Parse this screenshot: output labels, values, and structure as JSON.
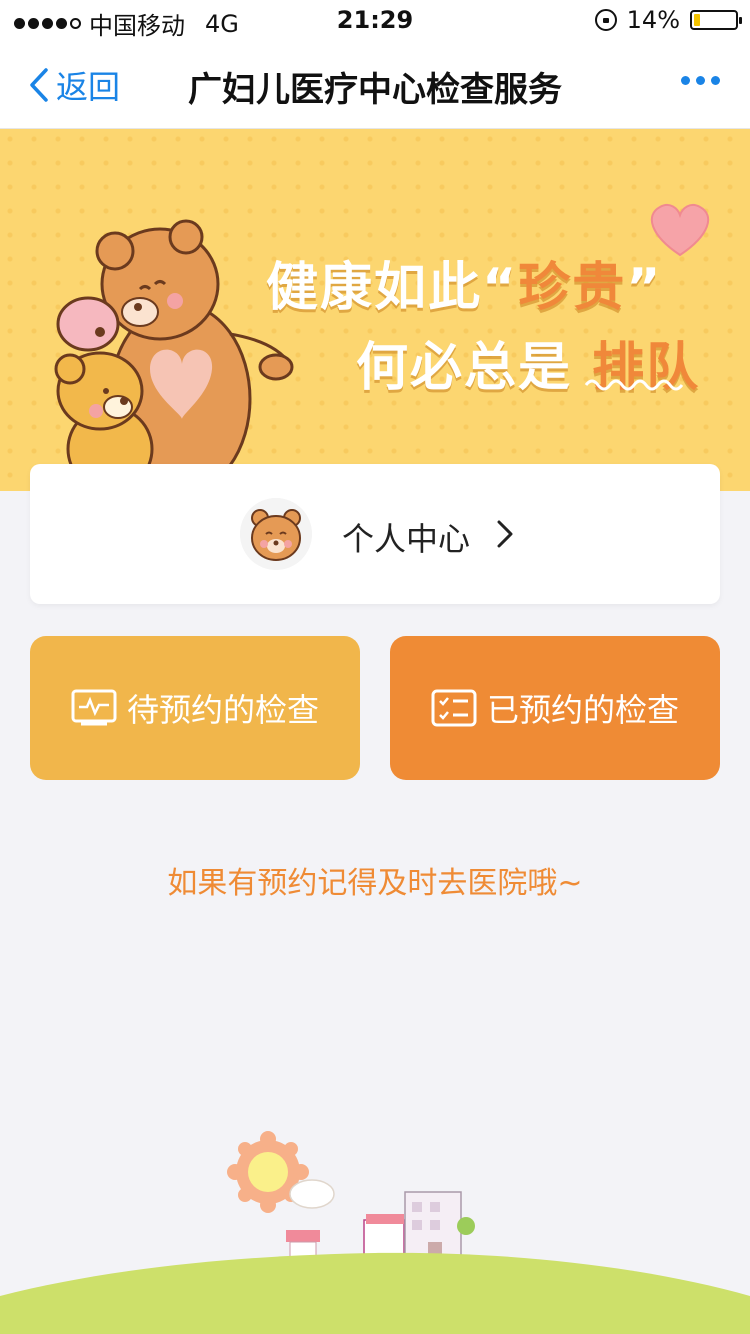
{
  "status_bar": {
    "carrier": "中国移动",
    "network": "4G",
    "time": "21:29",
    "battery": "14%",
    "battery_level": 0.14
  },
  "navbar": {
    "back_label": "返回",
    "title": "广妇儿医疗中心检查服务"
  },
  "banner": {
    "line1_prefix": "健康如此“",
    "line1_highlight": "珍贵",
    "line1_suffix": "”",
    "line2_prefix": "何必总是",
    "line2_highlight": "排队"
  },
  "profile_card": {
    "label": "个人中心"
  },
  "actions": {
    "pending_label": "待预约的检查",
    "booked_label": "已预约的检查"
  },
  "hint": "如果有预约记得及时去医院哦~",
  "colors": {
    "accent_blue": "#1a84e6",
    "banner_yellow": "#fcd670",
    "pending_button": "#f1b64b",
    "booked_button": "#ef8b35",
    "hint_text": "#ef8b35",
    "ground_green": "#cde06a"
  }
}
